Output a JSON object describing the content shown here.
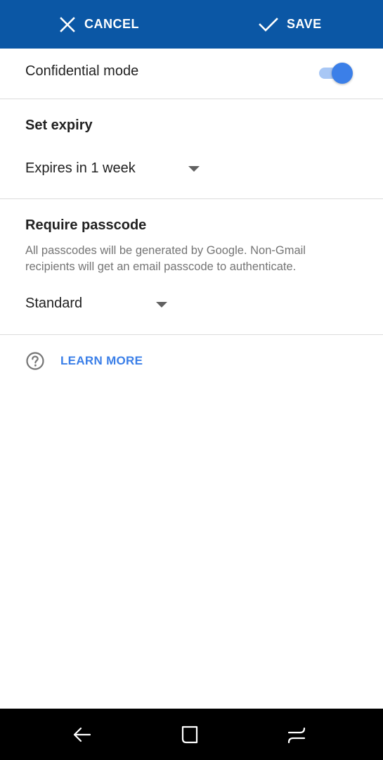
{
  "toolbar": {
    "cancel_label": "CANCEL",
    "save_label": "SAVE",
    "background_color": "#0b57a5"
  },
  "confidential": {
    "label": "Confidential mode",
    "enabled": true,
    "accent_color": "#3b7fe8"
  },
  "expiry": {
    "title": "Set expiry",
    "selected": "Expires in 1 week"
  },
  "passcode": {
    "title": "Require passcode",
    "description": "All passcodes will be generated by Google. Non-Gmail recipients will get an email passcode to authenticate.",
    "selected": "Standard"
  },
  "learn_more": {
    "label": "LEARN MORE",
    "icon": "help-circle-icon"
  },
  "system_nav": {
    "icons": [
      "back-arrow-icon",
      "home-icon",
      "recent-apps-icon"
    ]
  }
}
